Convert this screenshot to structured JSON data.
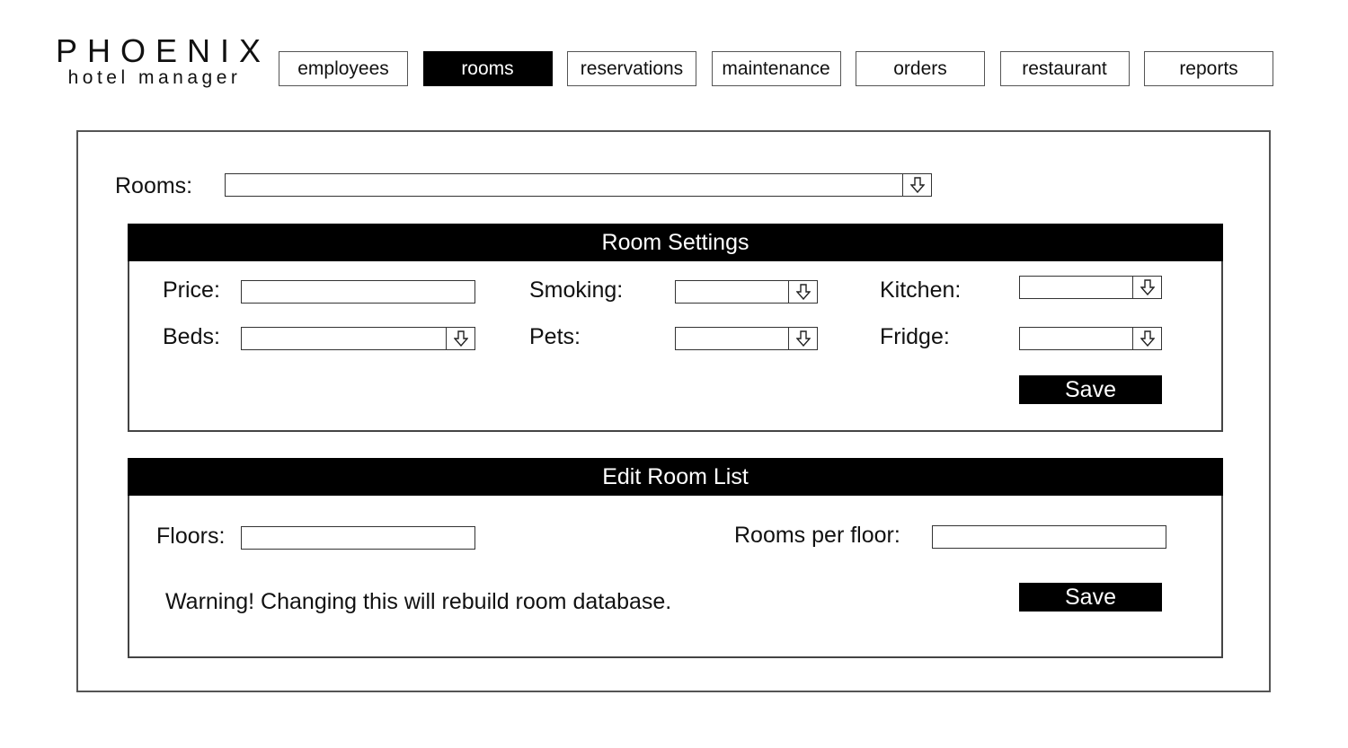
{
  "logo": {
    "name": "PHOENIX",
    "subtitle": "hotel manager"
  },
  "nav": {
    "tabs": [
      {
        "label": "employees",
        "active": false
      },
      {
        "label": "rooms",
        "active": true
      },
      {
        "label": "reservations",
        "active": false
      },
      {
        "label": "maintenance",
        "active": false
      },
      {
        "label": "orders",
        "active": false
      },
      {
        "label": "restaurant",
        "active": false
      },
      {
        "label": "reports",
        "active": false
      }
    ]
  },
  "rooms_selector": {
    "label": "Rooms:",
    "value": ""
  },
  "room_settings": {
    "title": "Room Settings",
    "price_label": "Price:",
    "price_value": "",
    "beds_label": "Beds:",
    "beds_value": "",
    "smoking_label": "Smoking:",
    "smoking_value": "",
    "pets_label": "Pets:",
    "pets_value": "",
    "kitchen_label": "Kitchen:",
    "kitchen_value": "",
    "fridge_label": "Fridge:",
    "fridge_value": "",
    "save_label": "Save"
  },
  "edit_room_list": {
    "title": "Edit Room List",
    "floors_label": "Floors:",
    "floors_value": "",
    "rooms_per_floor_label": "Rooms per floor:",
    "rooms_per_floor_value": "",
    "warning": "Warning! Changing this will rebuild room database.",
    "save_label": "Save"
  },
  "icons": {
    "dropdown": "arrow-down-icon"
  },
  "colors": {
    "active_tab_bg": "#000000",
    "header_bg": "#000000",
    "button_bg": "#000000",
    "border": "#555555"
  }
}
